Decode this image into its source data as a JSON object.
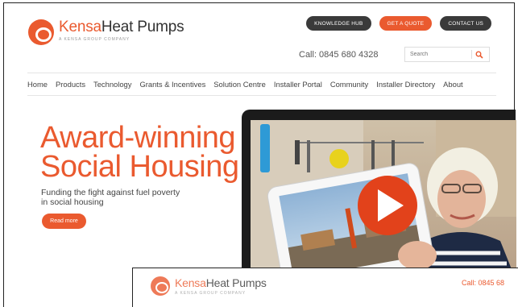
{
  "header": {
    "logo": {
      "brand_a": "Kensa",
      "brand_b": "Heat Pumps",
      "tagline": "A KENSA GROUP COMPANY"
    },
    "buttons": [
      "KNOWLEDGE HUB",
      "GET A QUOTE",
      "CONTACT US"
    ],
    "phone": "Call: 0845 680 4328",
    "search": {
      "placeholder": "Search"
    }
  },
  "nav": {
    "items": [
      "Home",
      "Products",
      "Technology",
      "Grants & Incentives",
      "Solution Centre",
      "Installer Portal",
      "Community",
      "Installer Directory",
      "About"
    ]
  },
  "hero": {
    "title_line1": "Award-winning",
    "title_line2": "Social Housing",
    "subtitle_line1": "Funding the fight against fuel poverty",
    "subtitle_line2": "in social housing",
    "read_more": "Read more"
  },
  "colors": {
    "accent": "#ea5a2f",
    "dark_button": "#3a3a3a"
  },
  "second_window": {
    "logo": {
      "brand_a": "Kensa",
      "brand_b": "Heat Pumps",
      "tagline": "A KENSA GROUP COMPANY"
    },
    "phone_partial": "Call: 0845 68"
  }
}
